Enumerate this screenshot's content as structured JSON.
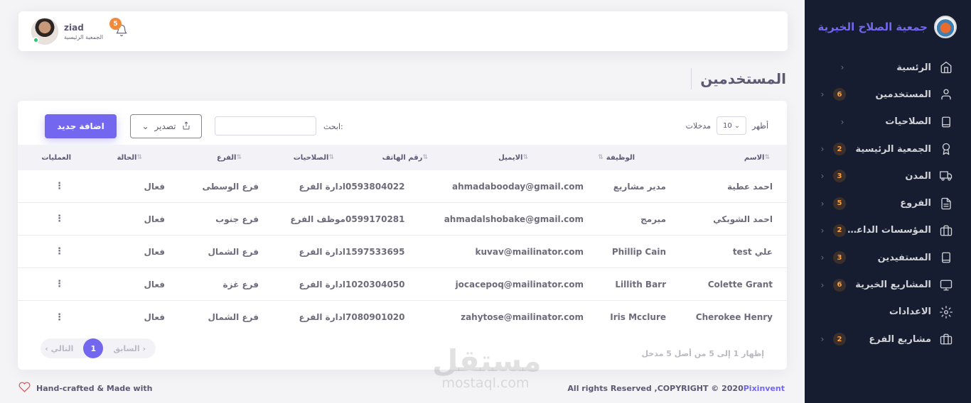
{
  "sidebar": {
    "brand": "جمعية الصلاح الخيرية",
    "items": [
      {
        "label": "الرئسية",
        "badge": "",
        "icon": "home-icon"
      },
      {
        "label": "المستخدمين",
        "badge": "6",
        "icon": "user-icon"
      },
      {
        "label": "الصلاحيات",
        "badge": "",
        "icon": "tablet-icon"
      },
      {
        "label": "الجمعية الرئيسية",
        "badge": "2",
        "icon": "award-icon"
      },
      {
        "label": "المدن",
        "badge": "3",
        "icon": "truck-icon"
      },
      {
        "label": "الفروع",
        "badge": "5",
        "icon": "file-text-icon"
      },
      {
        "label": "المؤسسات الداعمة",
        "badge": "2",
        "icon": "briefcase-icon"
      },
      {
        "label": "المستفيدين",
        "badge": "3",
        "icon": "tablet-icon"
      },
      {
        "label": "المشاريع الخيرية",
        "badge": "6",
        "icon": "monitor-icon"
      },
      {
        "label": "الاعدادات",
        "badge": "",
        "icon": "settings-icon"
      },
      {
        "label": "مشاريع الفرع",
        "badge": "2",
        "icon": "briefcase-icon"
      }
    ]
  },
  "navbar": {
    "user_name": "ziad",
    "user_role": "الجمعية الرئيسية",
    "notifications": "5"
  },
  "page": {
    "title": "المستخدمين"
  },
  "controls": {
    "show_label": "أظهر",
    "entries_value": "10",
    "entries_label": "مدخلات",
    "search_label": "ابحث:",
    "search_value": "",
    "export_label": "تصدير",
    "add_label": "اضافة جديد"
  },
  "table": {
    "headers": [
      "الاسم",
      "الوظيفة",
      "الايميل",
      "رقم الهاتف",
      "الصلاحيات",
      "الفرع",
      "الحالة",
      "العمليات"
    ],
    "rows": [
      [
        "احمد عطية",
        "مدير مشاريع",
        "ahmadabooday@gmail.com",
        "0593804022",
        "ادارة الفرع",
        "فرع الوسطى",
        "فعال"
      ],
      [
        "احمد الشوبكي",
        "مبرمج",
        "ahmadalshobake@gmail.com",
        "0599170281",
        "موظف الفرع",
        "فرع جنوب",
        "فعال"
      ],
      [
        "علي test",
        "Phillip Cain",
        "kuvav@mailinator.com",
        "1597533695",
        "ادارة الفرع",
        "فرع الشمال",
        "فعال"
      ],
      [
        "Colette Grant",
        "Lillith Barr",
        "jocacepoq@mailinator.com",
        "1020304050",
        "ادارة الفرع",
        "فرع غزة",
        "فعال"
      ],
      [
        "Cherokee Henry",
        "Iris Mcclure",
        "zahytose@mailinator.com",
        "7080901020",
        "ادارة الفرع",
        "فرع الشمال",
        "فعال"
      ]
    ]
  },
  "pagination": {
    "info": "إظهار 1 إلى 5 من أصل 5 مدخل",
    "prev": "‹ السابق",
    "page": "1",
    "next": "التالي ›"
  },
  "footer": {
    "left": "Hand-crafted & Made with",
    "right_text": "All rights Reserved ,COPYRIGHT © 2020",
    "right_link": "Pixinvent"
  },
  "watermark": {
    "arabic": "مستقل",
    "latin": "mostaql.com"
  }
}
